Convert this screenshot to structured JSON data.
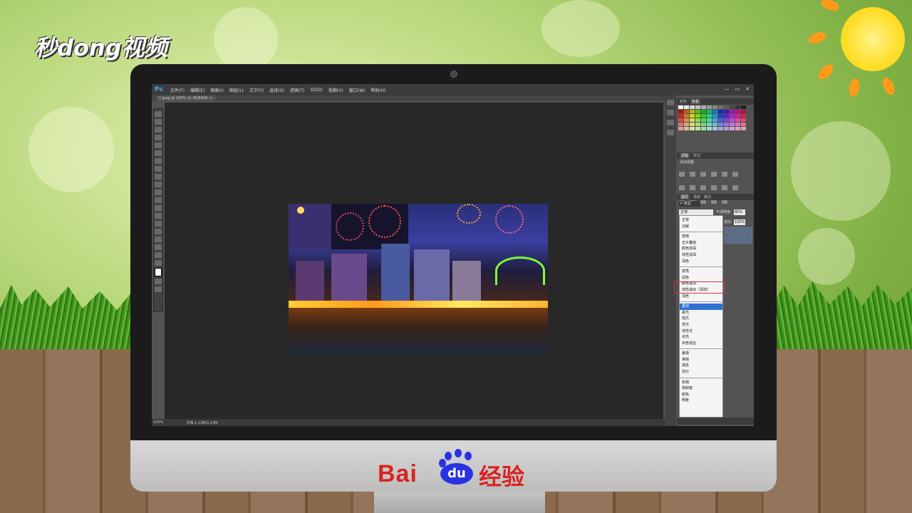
{
  "watermark": {
    "logo_text": "秒dong视频"
  },
  "brand": {
    "bai": "Bai",
    "du": "du",
    "jingyan": "经验"
  },
  "photoshop": {
    "app_logo": "Ps",
    "menu": [
      "文件(F)",
      "编辑(E)",
      "图像(I)",
      "图层(L)",
      "文字(Y)",
      "选择(S)",
      "滤镜(T)",
      "3D(D)",
      "视图(V)",
      "窗口(W)",
      "帮助(H)"
    ],
    "window_controls": [
      "—",
      "▭",
      "✕"
    ],
    "document_tab": "1.jpeg @ 100% (1, RGB/8#) ×",
    "status": {
      "zoom": "100%",
      "doc_size": "文档:1.13M/2.13M"
    },
    "panels": {
      "swatches_tabs": [
        "颜色",
        "色板"
      ],
      "adjustments_tabs": [
        "调整",
        "样式"
      ],
      "adjustments_label": "添加调整",
      "layers_tabs": [
        "图层",
        "通道",
        "路径"
      ],
      "layer_kind": "P 类型",
      "blend_mode_current": "正常",
      "opacity_label": "不透明度:",
      "opacity_value": "80%",
      "fill_label": "填充:",
      "fill_value": "100%"
    },
    "blend_modes": [
      [
        "正常",
        "溶解"
      ],
      [
        "变暗",
        "正片叠底",
        "颜色加深",
        "线性加深",
        "深色"
      ],
      [
        "变亮",
        "滤色",
        "颜色减淡",
        "线性减淡（添加）",
        "浅色"
      ],
      [
        "叠加",
        "柔光",
        "强光",
        "亮光",
        "线性光",
        "点光",
        "实色混合"
      ],
      [
        "差值",
        "排除",
        "减去",
        "划分"
      ],
      [
        "色相",
        "饱和度",
        "颜色",
        "明度"
      ]
    ],
    "blend_selected": "叠加"
  }
}
